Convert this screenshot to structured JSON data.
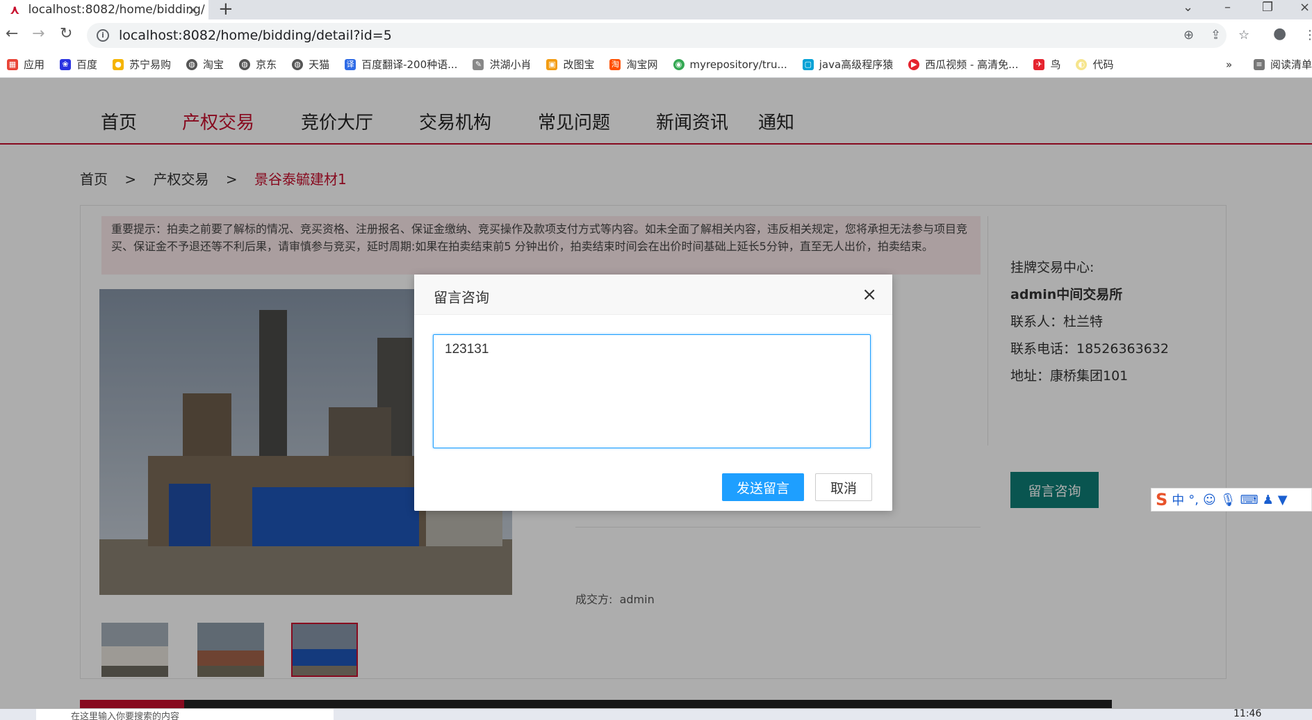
{
  "browser": {
    "tab_title": "localhost:8082/home/bidding/",
    "url": "localhost:8082/home/bidding/detail?id=5",
    "bookmarks": [
      "应用",
      "百度",
      "苏宁易购",
      "淘宝",
      "京东",
      "天猫",
      "百度翻译-200种语...",
      "洪湖小肖",
      "改图宝",
      "淘宝网",
      "myrepository/tru...",
      "java高级程序猿",
      "西瓜视频 - 高清免...",
      "鸟",
      "代码"
    ],
    "bookmarks_more": "»",
    "reading_list": "阅读清单"
  },
  "nav": {
    "items": [
      "首页",
      "产权交易",
      "竞价大厅",
      "交易机构",
      "常见问题",
      "新闻资讯",
      "通知"
    ],
    "active_index": 1
  },
  "breadcrumb": {
    "home": "首页",
    "sep": ">",
    "section": "产权交易",
    "current": "景谷泰毓建材1"
  },
  "notice": "重要提示：拍卖之前要了解标的情况、竞买资格、注册报名、保证金缴纳、竞买操作及款项支付方式等内容。如未全面了解相关内容，违反相关规定，您将承担无法参与项目竞买、保证金不予退还等不利后果，请审慎参与竞买，延时周期:如果在拍卖结束前5 分钟出价，拍卖结束时间会在出价时间基础上延长5分钟，直至无人出价，拍卖结束。",
  "side": {
    "center_label": "挂牌交易中心:",
    "center_name": "admin中间交易所",
    "contact": "联系人：杜兰特",
    "phone": "联系电话：18526363632",
    "address": "地址：康桥集团101",
    "consult_button": "留言咨询"
  },
  "deal": {
    "label": "成交方:",
    "value": "admin"
  },
  "dialog": {
    "title": "留言咨询",
    "close": "×",
    "message": "123131",
    "send_button": "发送留言",
    "cancel_button": "取消"
  },
  "ime": {
    "logo": "S",
    "lang": "中",
    "punct": "°,"
  },
  "taskbar": {
    "search_placeholder": "在这里输入你要搜索的内容",
    "time": "11:46"
  }
}
